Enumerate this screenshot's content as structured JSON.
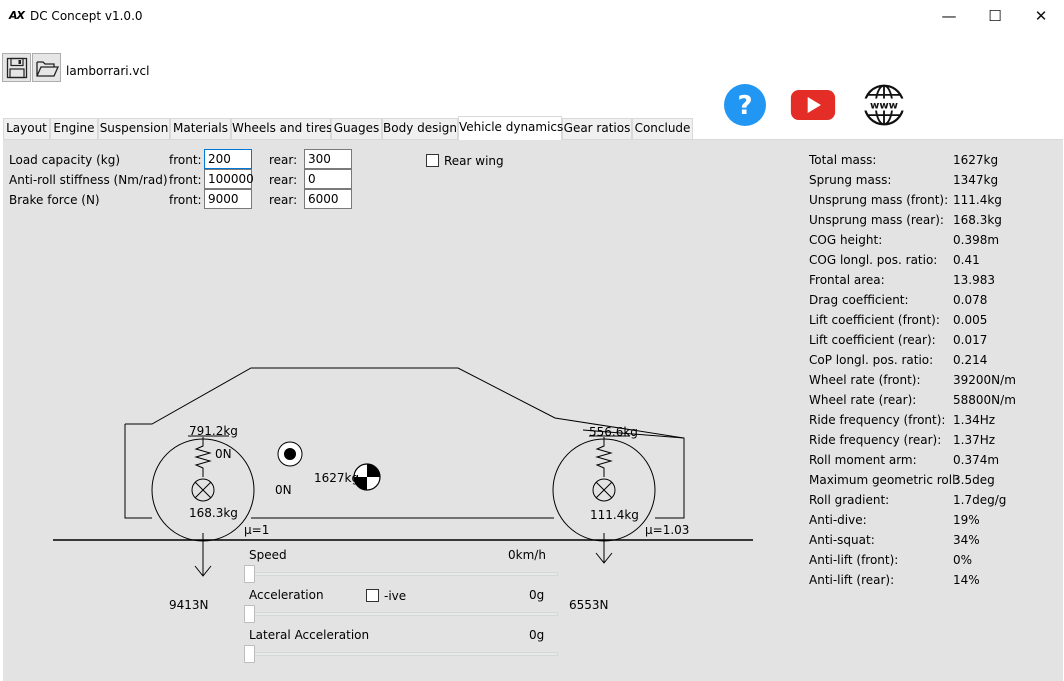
{
  "window": {
    "logo": "AX",
    "title": "DC Concept v1.0.0",
    "minimize": "—",
    "maximize": "☐",
    "close": "✕"
  },
  "toolbar": {
    "filename": "lamborrari.vcl"
  },
  "tabs": [
    "Layout",
    "Engine",
    "Suspension",
    "Materials",
    "Wheels and tires",
    "Guages",
    "Body design",
    "Vehicle dynamics",
    "Gear ratios",
    "Conclude"
  ],
  "active_tab": "Vehicle dynamics",
  "colors": {
    "help": "#2196f3",
    "youtube": "#e52d27",
    "panel": "#e3e3e3"
  },
  "inputs": {
    "load_label": "Load capacity (kg)",
    "antiroll_label": "Anti-roll stiffness (Nm/rad)",
    "brake_label": "Brake force (N)",
    "front_label": "front:",
    "rear_label": "rear:",
    "load_front": "200",
    "load_rear": "300",
    "antiroll_front": "100000",
    "antiroll_rear": "0",
    "brake_front": "9000",
    "brake_rear": "6000",
    "rear_wing_label": "Rear wing",
    "rear_wing_checked": false
  },
  "diagram": {
    "front_axle_load": "791.2kg",
    "rear_axle_load": "556.6kg",
    "front_spring_force": "0N",
    "front_unsprung": "168.3kg",
    "rear_unsprung": "111.4kg",
    "aero_force": "0N",
    "total_mass": "1627kg",
    "front_mu": "μ=1",
    "rear_mu": "μ=1.03",
    "front_reaction": "9413N",
    "rear_reaction": "6553N"
  },
  "sliders": {
    "speed_label": "Speed",
    "speed_value": "0km/h",
    "accel_label": "Acceleration",
    "accel_value": "0g",
    "neg_label": "-ive",
    "neg_checked": false,
    "lat_label": "Lateral Acceleration",
    "lat_value": "0g"
  },
  "stats": [
    {
      "k": "Total mass:",
      "v": "1627kg"
    },
    {
      "k": "Sprung mass:",
      "v": "1347kg"
    },
    {
      "k": "Unsprung mass (front):",
      "v": "111.4kg"
    },
    {
      "k": "Unsprung mass (rear):",
      "v": "168.3kg"
    },
    {
      "k": "COG height:",
      "v": "0.398m"
    },
    {
      "k": "COG longl. pos. ratio:",
      "v": "0.41"
    },
    {
      "k": "Frontal area:",
      "v": "13.983"
    },
    {
      "k": "Drag coefficient:",
      "v": "0.078"
    },
    {
      "k": "Lift coefficient (front):",
      "v": "0.005"
    },
    {
      "k": "Lift coefficient (rear):",
      "v": "0.017"
    },
    {
      "k": "CoP longl. pos. ratio:",
      "v": "0.214"
    },
    {
      "k": "Wheel rate (front):",
      "v": "39200N/m"
    },
    {
      "k": "Wheel rate (rear):",
      "v": "58800N/m"
    },
    {
      "k": "Ride frequency (front):",
      "v": "1.34Hz"
    },
    {
      "k": "Ride frequency (rear):",
      "v": "1.37Hz"
    },
    {
      "k": "Roll moment arm:",
      "v": "0.374m"
    },
    {
      "k": "Maximum geometric roll:",
      "v": "3.5deg"
    },
    {
      "k": "Roll gradient:",
      "v": "1.7deg/g"
    },
    {
      "k": "Anti-dive:",
      "v": "19%"
    },
    {
      "k": "Anti-squat:",
      "v": "34%"
    },
    {
      "k": "Anti-lift (front):",
      "v": "0%"
    },
    {
      "k": "Anti-lift (rear):",
      "v": "14%"
    }
  ]
}
